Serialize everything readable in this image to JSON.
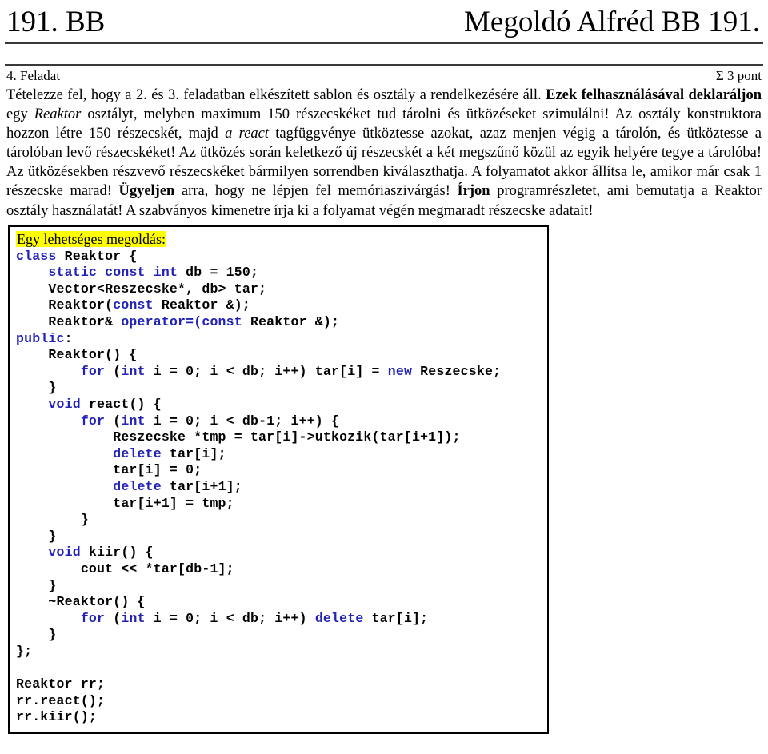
{
  "header": {
    "left_title": "191. BB",
    "right_title": "Megoldó Alfréd BB 191."
  },
  "task": {
    "number_label": "4. Feladat",
    "points_label": "Σ 3 pont",
    "body_parts": [
      {
        "text": "Tételezze fel, hogy a 2. és 3. feladatban elkészített sablon és osztály a rendelkezésére áll. ",
        "style": "normal"
      },
      {
        "text": "Ezek felhasználásával deklaráljon",
        "style": "bold"
      },
      {
        "text": " egy ",
        "style": "normal"
      },
      {
        "text": "Reaktor",
        "style": "italic"
      },
      {
        "text": " osztályt, melyben maximum 150 részecskéket tud tárolni és ütközéseket szimulálni! Az osztály konstruktora hozzon létre 150 részecskét, majd ",
        "style": "normal"
      },
      {
        "text": "a react",
        "style": "italic"
      },
      {
        "text": " tagfüggvénye ütköztesse azokat, azaz menjen végig a tárolón, és ütköztesse a tárolóban levő részecskéket! Az ütközés során keletkező új részecskét a két megszűnő közül az egyik helyére tegye a tárolóba!  Az ütközésekben részvevő részecskéket bármilyen sorrendben kiválaszthatja. A folyamatot akkor állítsa le, amikor már csak 1 részecske marad! ",
        "style": "normal"
      },
      {
        "text": "Ügyeljen",
        "style": "bold"
      },
      {
        "text": " arra, hogy ne lépjen fel memóriaszivárgás! ",
        "style": "normal"
      },
      {
        "text": "Írjon",
        "style": "bold"
      },
      {
        "text": " programrészletet, ami bemutatja a Reaktor osztály használatát! A szabványos kimenetre írja ki a folyamat végén megmaradt részecske adatait!",
        "style": "normal"
      }
    ]
  },
  "code_block": {
    "caption": "Egy lehetséges megoldás:",
    "caption_highlight_color": "#ffff00",
    "keyword_color": "#2222bb",
    "lines": [
      [
        {
          "t": "class",
          "k": true
        },
        {
          "t": " Reaktor {",
          "k": false
        }
      ],
      [
        {
          "t": "    ",
          "k": false
        },
        {
          "t": "static const int",
          "k": true
        },
        {
          "t": " db = 150;",
          "k": false
        }
      ],
      [
        {
          "t": "    Vector<Reszecske*, db> tar;",
          "k": false
        }
      ],
      [
        {
          "t": "    Reaktor(",
          "k": false
        },
        {
          "t": "const",
          "k": true
        },
        {
          "t": " Reaktor &);",
          "k": false
        }
      ],
      [
        {
          "t": "    Reaktor& ",
          "k": false
        },
        {
          "t": "operator=(const",
          "k": true
        },
        {
          "t": " Reaktor &);",
          "k": false
        }
      ],
      [
        {
          "t": "public",
          "k": true
        },
        {
          "t": ":",
          "k": false
        }
      ],
      [
        {
          "t": "    Reaktor() {",
          "k": false
        }
      ],
      [
        {
          "t": "        ",
          "k": false
        },
        {
          "t": "for",
          "k": true
        },
        {
          "t": " (",
          "k": false
        },
        {
          "t": "int",
          "k": true
        },
        {
          "t": " i = 0; i < db; i++) tar[i] = ",
          "k": false
        },
        {
          "t": "new",
          "k": true
        },
        {
          "t": " Reszecske;",
          "k": false
        }
      ],
      [
        {
          "t": "    }",
          "k": false
        }
      ],
      [
        {
          "t": "    ",
          "k": false
        },
        {
          "t": "void",
          "k": true
        },
        {
          "t": " react() {",
          "k": false
        }
      ],
      [
        {
          "t": "        ",
          "k": false
        },
        {
          "t": "for",
          "k": true
        },
        {
          "t": " (",
          "k": false
        },
        {
          "t": "int",
          "k": true
        },
        {
          "t": " i = 0; i < db-1; i++) {",
          "k": false
        }
      ],
      [
        {
          "t": "            Reszecske *tmp = tar[i]->utkozik(tar[i+1]);",
          "k": false
        }
      ],
      [
        {
          "t": "            ",
          "k": false
        },
        {
          "t": "delete",
          "k": true
        },
        {
          "t": " tar[i];",
          "k": false
        }
      ],
      [
        {
          "t": "            tar[i] = 0;",
          "k": false
        }
      ],
      [
        {
          "t": "            ",
          "k": false
        },
        {
          "t": "delete",
          "k": true
        },
        {
          "t": " tar[i+1];",
          "k": false
        }
      ],
      [
        {
          "t": "            tar[i+1] = tmp;",
          "k": false
        }
      ],
      [
        {
          "t": "        }",
          "k": false
        }
      ],
      [
        {
          "t": "    }",
          "k": false
        }
      ],
      [
        {
          "t": "    ",
          "k": false
        },
        {
          "t": "void",
          "k": true
        },
        {
          "t": " kiir() {",
          "k": false
        }
      ],
      [
        {
          "t": "        cout << *tar[db-1];",
          "k": false
        }
      ],
      [
        {
          "t": "    }",
          "k": false
        }
      ],
      [
        {
          "t": "    ~Reaktor() {",
          "k": false
        }
      ],
      [
        {
          "t": "        ",
          "k": false
        },
        {
          "t": "for",
          "k": true
        },
        {
          "t": " (",
          "k": false
        },
        {
          "t": "int",
          "k": true
        },
        {
          "t": " i = 0; i < db; i++) ",
          "k": false
        },
        {
          "t": "delete",
          "k": true
        },
        {
          "t": " tar[i];",
          "k": false
        }
      ],
      [
        {
          "t": "    }",
          "k": false
        }
      ],
      [
        {
          "t": "};",
          "k": false
        }
      ],
      [
        {
          "t": "",
          "k": false
        }
      ],
      [
        {
          "t": "Reaktor rr;",
          "k": false
        }
      ],
      [
        {
          "t": "rr.react();",
          "k": false
        }
      ],
      [
        {
          "t": "rr.kiir();",
          "k": false
        }
      ]
    ]
  }
}
